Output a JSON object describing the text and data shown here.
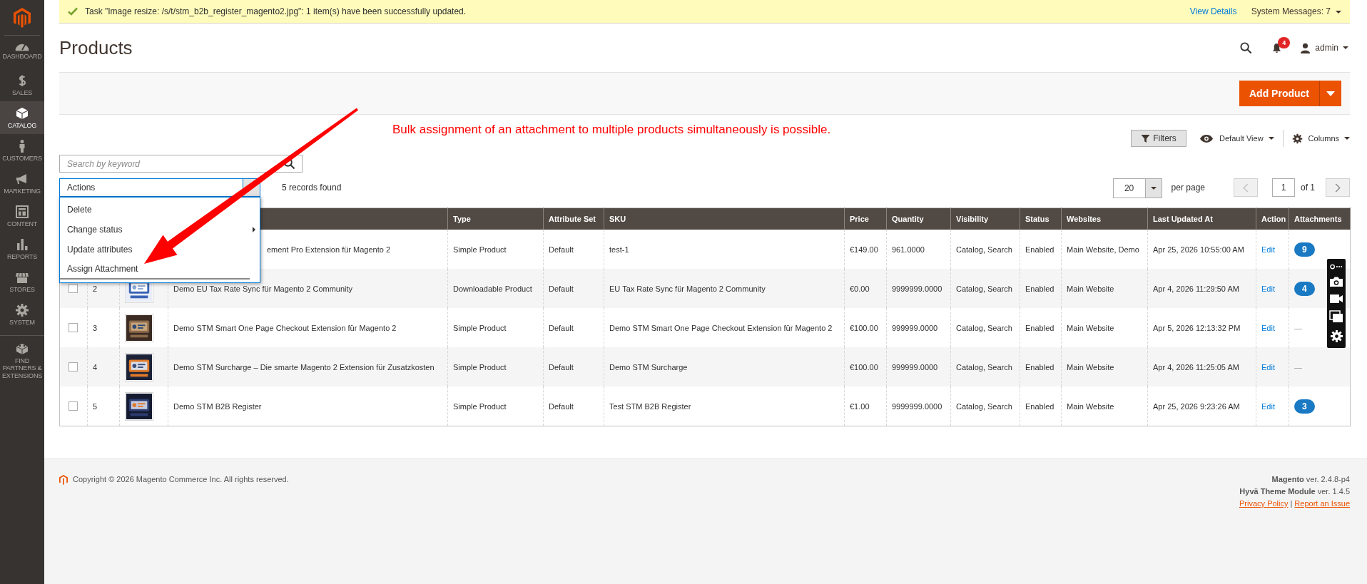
{
  "sidebar": {
    "items": [
      {
        "label": "DASHBOARD",
        "kind": "gauge",
        "selected": false
      },
      {
        "label": "SALES",
        "kind": "dollar",
        "selected": false
      },
      {
        "label": "CATALOG",
        "kind": "box",
        "selected": true
      },
      {
        "label": "CUSTOMERS",
        "kind": "person",
        "selected": false
      },
      {
        "label": "MARKETING",
        "kind": "megaphone",
        "selected": false
      },
      {
        "label": "CONTENT",
        "kind": "layout",
        "selected": false
      },
      {
        "label": "REPORTS",
        "kind": "bars",
        "selected": false
      },
      {
        "label": "STORES",
        "kind": "store",
        "selected": false
      },
      {
        "label": "SYSTEM",
        "kind": "gear",
        "selected": false
      },
      {
        "label": "FIND PARTNERS & EXTENSIONS",
        "kind": "blocks",
        "selected": false
      }
    ]
  },
  "notice": {
    "text": "Task \"Image resize: /s/t/stm_b2b_register_magento2.jpg\": 1 item(s) have been successfully updated.",
    "link": "View Details",
    "system_messages": "System Messages: 7"
  },
  "header": {
    "title": "Products",
    "notifications": "4",
    "user": "admin"
  },
  "page_actions": {
    "add_button": "Add Product"
  },
  "annotation": "Bulk assignment of an attachment to multiple products simultaneously is possible.",
  "grid_toolbar": {
    "filters": "Filters",
    "view": "Default View",
    "columns": "Columns"
  },
  "search": {
    "placeholder": "Search by keyword"
  },
  "actions": {
    "label": "Actions",
    "expanded": true,
    "items": [
      {
        "label": "Delete",
        "submenu": false,
        "selected": false
      },
      {
        "label": "Change status",
        "submenu": true,
        "selected": false
      },
      {
        "label": "Update attributes",
        "submenu": false,
        "selected": false
      },
      {
        "label": "Assign Attachment",
        "submenu": false,
        "selected": true
      }
    ]
  },
  "records": "5 records found",
  "pagination": {
    "per_page": "20",
    "per_page_label": "per page",
    "page": "1",
    "of": "of 1"
  },
  "table": {
    "columns": [
      "Type",
      "Attribute Set",
      "SKU",
      "Price",
      "Quantity",
      "Visibility",
      "Status",
      "Websites",
      "Last Updated At",
      "Action",
      "Attachments"
    ],
    "rows": [
      {
        "name": "ement Pro Extension für Magento 2",
        "type": "Simple Product",
        "attribute_set": "Default",
        "sku": "test-1",
        "price": "€149.00",
        "quantity": "961.0000",
        "visibility": "Catalog, Search",
        "status": "Enabled",
        "websites": "Main Website, Demo",
        "updated": "Apr 25, 2026 10:55:00 AM",
        "action": "Edit",
        "attachments": {
          "kind": "badge",
          "text": "9"
        }
      },
      {
        "checked": false,
        "id": "2",
        "name": "Demo EU Tax Rate Sync für Magento 2 Community",
        "type": "Downloadable Product",
        "attribute_set": "Default",
        "sku": "EU Tax Rate Sync für Magento 2 Community",
        "price": "€0.00",
        "quantity": "9999999.0000",
        "visibility": "Catalog, Search",
        "status": "Enabled",
        "websites": "Main Website",
        "updated": "Apr 4, 2026 11:29:50 AM",
        "action": "Edit",
        "attachments": {
          "kind": "badge",
          "text": "4"
        }
      },
      {
        "checked": false,
        "id": "3",
        "name": "Demo STM Smart One Page Checkout Extension für Magento 2",
        "type": "Simple Product",
        "attribute_set": "Default",
        "sku": "Demo STM Smart One Page Checkout Extension für Magento 2",
        "price": "€100.00",
        "quantity": "999999.0000",
        "visibility": "Catalog, Search",
        "status": "Enabled",
        "websites": "Main Website",
        "updated": "Apr 5, 2026 12:13:32 PM",
        "action": "Edit",
        "attachments": {
          "kind": "dash",
          "text": "—"
        }
      },
      {
        "checked": false,
        "id": "4",
        "name": "Demo STM Surcharge – Die smarte Magento 2 Extension für Zusatzkosten",
        "type": "Simple Product",
        "attribute_set": "Default",
        "sku": "Demo STM Surcharge",
        "price": "€100.00",
        "quantity": "999999.0000",
        "visibility": "Catalog, Search",
        "status": "Enabled",
        "websites": "Main Website",
        "updated": "Apr 4, 2026 11:25:05 AM",
        "action": "Edit",
        "attachments": {
          "kind": "dash",
          "text": "—"
        }
      },
      {
        "checked": false,
        "id": "5",
        "name": "Demo STM B2B Register",
        "type": "Simple Product",
        "attribute_set": "Default",
        "sku": "Test STM B2B Register",
        "price": "€1.00",
        "quantity": "9999999.0000",
        "visibility": "Catalog, Search",
        "status": "Enabled",
        "websites": "Main Website",
        "updated": "Apr 25, 2026 9:23:26 AM",
        "action": "Edit",
        "attachments": {
          "kind": "badge",
          "text": "3"
        }
      }
    ]
  },
  "footer": {
    "copyright": "Copyright © 2026 Magento Commerce Inc. All rights reserved.",
    "versions": [
      "**Magento** ver. 2.4.8-p4",
      "**Hyvä Theme Module** ver. 1.4.5"
    ],
    "links": [
      "Privacy Policy",
      "Report an Issue"
    ],
    "separator": "|"
  }
}
